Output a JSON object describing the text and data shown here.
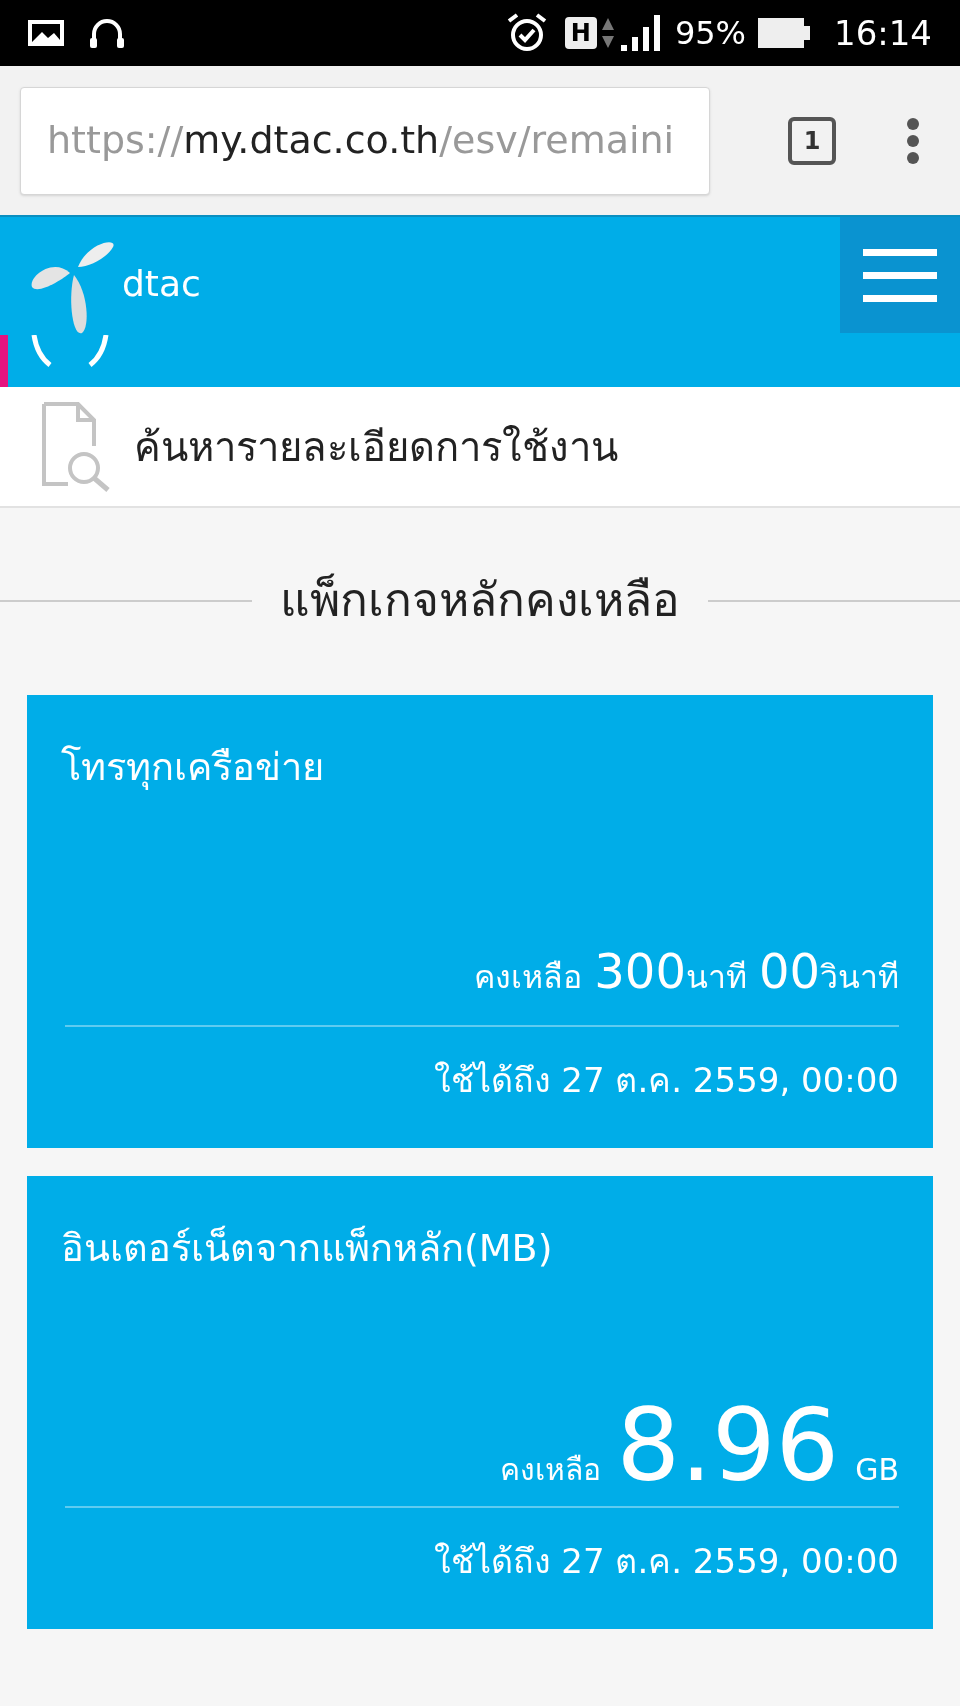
{
  "status_bar": {
    "battery": "95%",
    "time": "16:14",
    "network": "H"
  },
  "browser": {
    "url_scheme": "https://",
    "url_host": "my.dtac.co.th",
    "url_path": "/esv/remaini",
    "tab_count": "1"
  },
  "header": {
    "logo_text": "dtac"
  },
  "menu_items": [
    {
      "kind": "usage",
      "selected": true
    },
    {
      "kind": "search",
      "label": "ค้นหารายละเอียดการใช้งาน",
      "selected": false
    }
  ],
  "section_title": "แพ็กเกจหลักคงเหลือ",
  "cards": [
    {
      "kind": "voice",
      "title": "โทรทุกเครือข่าย",
      "remaining_label": "คงเหลือ",
      "amount": "300",
      "unit": "นาที",
      "amount_2": "00",
      "unit_2": "วินาที",
      "expiry": "ใช้ได้ถึง 27 ต.ค. 2559, 00:00"
    },
    {
      "kind": "data",
      "title": "อินเตอร์เน็ตจากแพ็กหลัก(MB)",
      "remaining_label": "คงเหลือ",
      "amount": "8.96",
      "unit": "GB",
      "expiry": "ใช้ได้ถึง 27 ต.ค. 2559, 00:00"
    }
  ]
}
